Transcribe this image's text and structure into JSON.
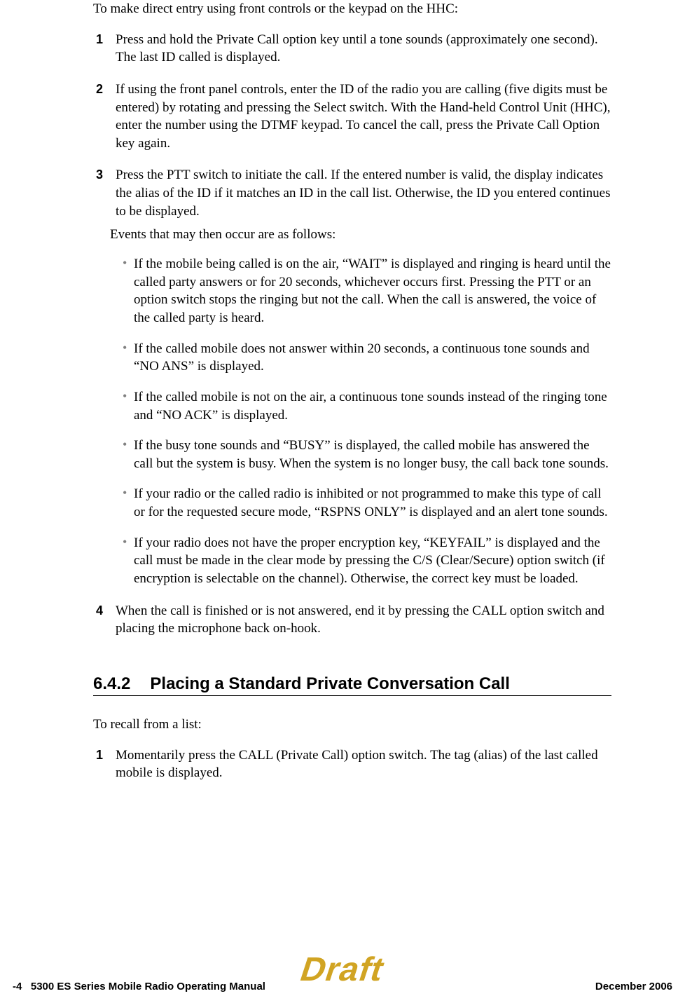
{
  "intro": "To make direct entry using front controls or the keypad on the HHC:",
  "steps": [
    {
      "num": "1",
      "text": "Press and hold the Private Call option key until a tone sounds (approximately one second). The last ID called is displayed."
    },
    {
      "num": "2",
      "text": "If using the front panel controls, enter the ID of the radio you are calling (five digits must be entered) by rotating and pressing the Select switch. With the Hand-held Control Unit (HHC), enter the number using the DTMF keypad. To cancel the call, press the Private Call Option key again."
    },
    {
      "num": "3",
      "text": "Press the PTT switch to initiate the call. If the entered number is valid, the display indicates the alias of the ID if it matches an ID in the call list. Otherwise, the ID you entered continues to be displayed."
    },
    {
      "num": "4",
      "text": "When the call is finished or is not answered, end it by pressing the CALL option switch and placing the microphone back on-hook."
    }
  ],
  "events_intro": "Events that may then occur are as follows:",
  "events": [
    "If the mobile being called is on the air, “WAIT” is displayed and ringing is heard until the called party answers or for 20 seconds, whichever occurs first. Pressing the PTT or an option switch stops the ringing but not the call. When the call is answered, the voice of the called party is heard.",
    "If the called mobile does not answer within 20 seconds, a continuous tone sounds and “NO ANS” is displayed.",
    "If the called mobile is not on the air, a continuous tone sounds instead of the ringing tone and “NO ACK” is displayed.",
    "If the busy tone sounds and “BUSY” is displayed, the called mobile has answered the call but the system is busy. When the system is no longer busy, the call back tone sounds.",
    "If your radio or the called radio is inhibited or not programmed to make this type of call or for the requested secure mode, “RSPNS ONLY” is displayed and an alert tone sounds.",
    "If your radio does not have the proper encryption key, “KEYFAIL” is displayed and the call must be made in the clear mode by pressing the C/S (Clear/Secure) option switch (if encryption is selectable on the channel). Otherwise, the correct key must be loaded."
  ],
  "section": {
    "number": "6.4.2",
    "title": "Placing a Standard Private Conversation Call",
    "intro": "To recall from a list:",
    "steps": [
      {
        "num": "1",
        "text": "Momentarily press the CALL (Private Call) option switch. The tag (alias) of the last called mobile is displayed."
      }
    ]
  },
  "footer": {
    "page": "-4",
    "title": "5300 ES Series Mobile Radio Operating Manual",
    "date": "December 2006"
  },
  "watermark": "Draft"
}
